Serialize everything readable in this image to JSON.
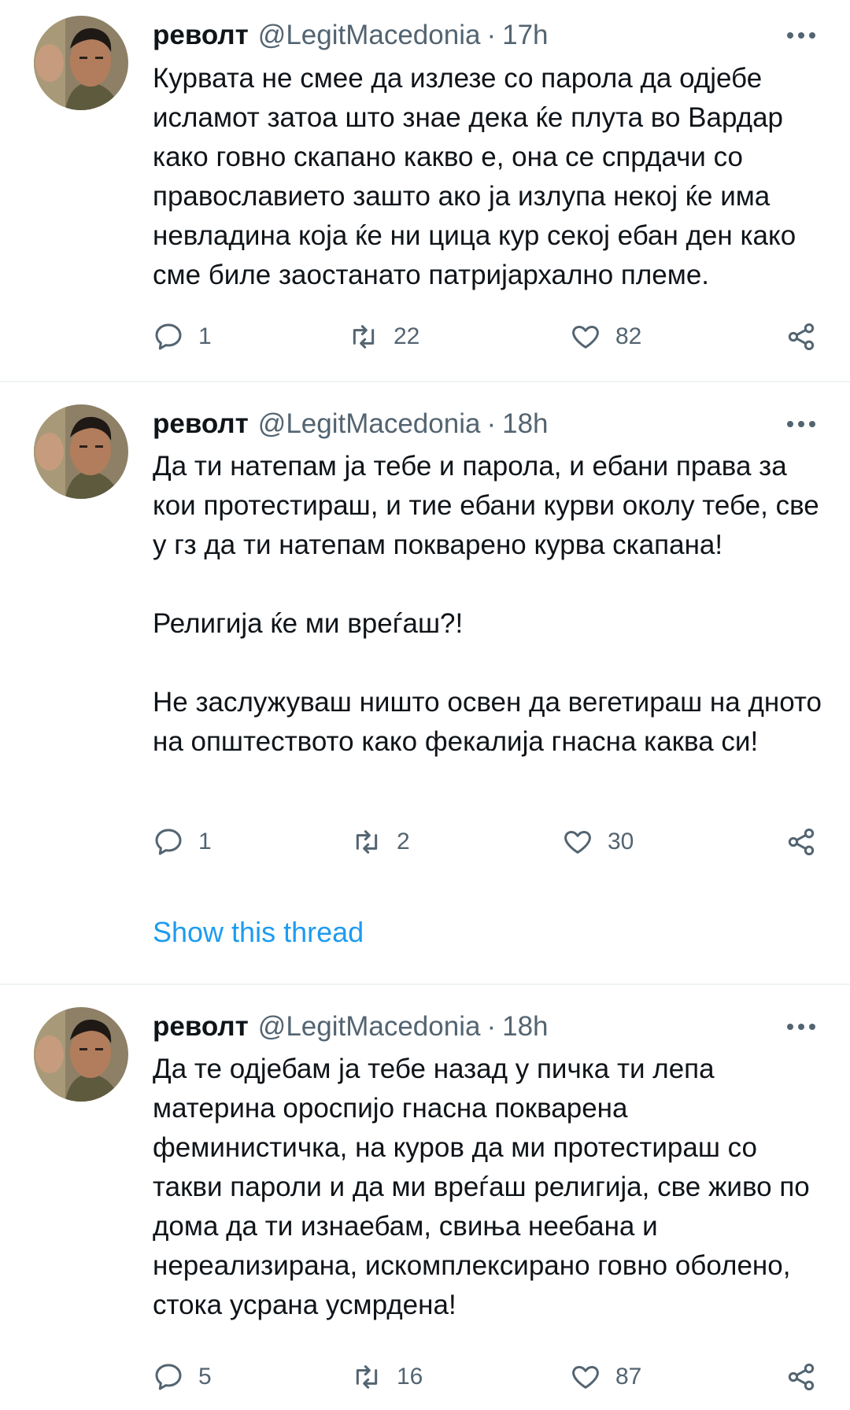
{
  "tweets": [
    {
      "name": "револт",
      "handle": "@LegitMacedonia",
      "separator": "·",
      "time": "17h",
      "text": "Курвата не смее да излезе со парола да одјебе исламот затоа што знае дека ќе плута во Вардар како говно скапано какво е, она се спрдачи со православието зашто ако ја излупа некој ќе има невладина која ќе ни цица кур секој ебан ден како сме биле заостанато патријархално племе.",
      "replies": "1",
      "retweets": "22",
      "likes": "82"
    },
    {
      "name": "револт",
      "handle": "@LegitMacedonia",
      "separator": "·",
      "time": "18h",
      "text": "Да ти натепам ја тебе и парола, и ебани права за кои протестираш, и тие ебани курви околу тебе, све у гз да ти натепам покварено курва скапана!\n\nРелигија ќе ми вреѓаш?!\n\nНе заслужуваш ништо освен да вегетираш на дното на општеството како фекалија гнасна каква си!",
      "replies": "1",
      "retweets": "2",
      "likes": "30",
      "show_thread": "Show this thread"
    },
    {
      "name": "револт",
      "handle": "@LegitMacedonia",
      "separator": "·",
      "time": "18h",
      "text": "Да те одјебам ја тебе назад у пичка ти лепа материна ороспијо гнасна покварена феминистичка, на куров да ми протестираш со такви пароли и да ми вреѓаш религија, све живо по дома да ти изнаебам, свиња неебана и нереализирана, искомплексирано говно оболено, стока усрана усмрдена!",
      "replies": "5",
      "retweets": "16",
      "likes": "87"
    }
  ],
  "icons": {
    "reply": "reply-icon",
    "retweet": "retweet-icon",
    "like": "heart-icon",
    "share": "share-icon",
    "more": "more-icon"
  },
  "colors": {
    "text": "#0f1419",
    "secondary": "#536471",
    "link": "#1d9bf0",
    "divider": "#eff3f4"
  }
}
